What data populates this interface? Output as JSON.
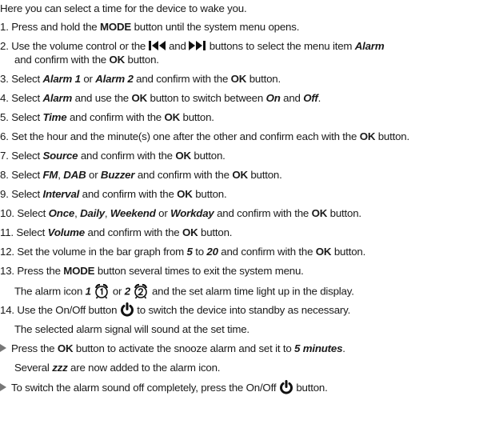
{
  "intro": "Here you can select a time for the device to wake you.",
  "steps": [
    {
      "n": "1.",
      "a": "Press and hold the ",
      "b": "MODE",
      "c": " button until the system menu opens."
    },
    {
      "n": "2.",
      "a": "Use the volume control or the ",
      "b": "and",
      "c": " buttons to select the menu item ",
      "d": "Alarm"
    },
    {
      "cont": "and confirm with the ",
      "b": "OK",
      "c": " button."
    },
    {
      "n": "3.",
      "a": "Select ",
      "i1": "Alarm 1",
      "m1": " or ",
      "i2": "Alarm 2",
      "m2": " and confirm with the ",
      "b": "OK",
      "c": " button."
    },
    {
      "n": "4.",
      "a": "Select ",
      "i1": "Alarm",
      "m1": " and use the ",
      "b": "OK",
      "m2": " button to switch between ",
      "i2": "On",
      "m3": " and ",
      "i3": "Off",
      "c": "."
    },
    {
      "n": "5.",
      "a": "Select ",
      "i1": "Time",
      "m1": " and confirm with the ",
      "b": "OK",
      "c": " button."
    },
    {
      "n": "6.",
      "a": "Set the hour and the minute(s) one after the other and confirm each with the ",
      "b": "OK",
      "c": " button."
    },
    {
      "n": "7.",
      "a": "Select ",
      "i1": "Source",
      "m1": " and confirm with the ",
      "b": "OK",
      "c": " button."
    },
    {
      "n": "8.",
      "a": "Select ",
      "i1": "FM",
      "m1": ", ",
      "i2": "DAB",
      "m2": " or ",
      "i3": "Buzzer",
      "m3": " and confirm with the ",
      "b": "OK",
      "c": " button."
    },
    {
      "n": "9.",
      "a": "Select ",
      "i1": "Interval",
      "m1": " and confirm with the ",
      "b": "OK",
      "c": " button."
    },
    {
      "n": "10.",
      "a": "Select ",
      "i1": "Once",
      "m1": ", ",
      "i2": "Daily",
      "m2": ", ",
      "i3": "Weekend",
      "m3": " or ",
      "i4": "Workday",
      "m4": " and confirm with the ",
      "b": "OK",
      "c": " button."
    },
    {
      "n": "11.",
      "a": "Select ",
      "i1": "Volume",
      "m1": " and confirm with the ",
      "b": "OK",
      "c": " button."
    },
    {
      "n": "12.",
      "a": "Set the volume in the bar graph from ",
      "i1": "5",
      "m1": " to ",
      "i2": "20",
      "m2": " and confirm with the ",
      "b": "OK",
      "c": " button."
    },
    {
      "n": "13.",
      "a": "Press the ",
      "b": "MODE",
      "c": " button several times to exit the system menu."
    },
    {
      "cont": "The alarm icon ",
      "i1": "1",
      "m1": " or ",
      "i2": "2",
      "c": " and the set alarm time light up in the display."
    },
    {
      "n": "14.",
      "a": "Use the On/Off button ",
      "c": " to switch the device into standby as necessary."
    },
    {
      "cont": "The selected alarm signal will sound at the set time."
    }
  ],
  "notes": [
    {
      "a": "Press the ",
      "b": "OK",
      "m1": " button to activate the snooze alarm and set it to ",
      "i1": "5 minutes",
      "c": "."
    },
    {
      "cont": "Several ",
      "i1": "zzz",
      "c": " are now added to the alarm icon."
    },
    {
      "a": "To switch the alarm sound off completely, press the On/Off ",
      "c": " button."
    }
  ],
  "icons": [
    "skip-back-icon",
    "skip-forward-icon",
    "alarm-clock-1-icon",
    "alarm-clock-2-icon",
    "power-icon",
    "arrow-bullet-icon"
  ]
}
